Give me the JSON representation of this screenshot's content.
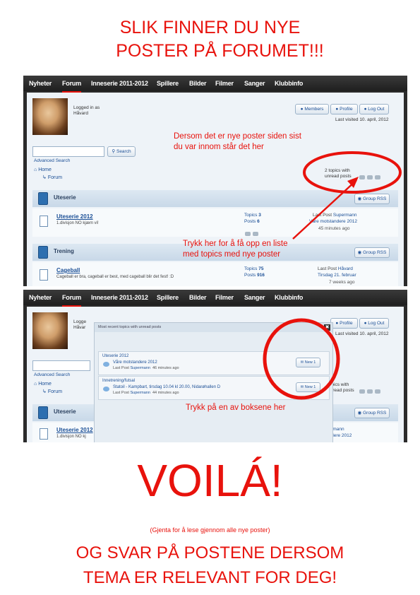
{
  "header": {
    "line1": "SLIK FINNER DU NYE",
    "line2": "POSTER PÅ FORUMET!!!"
  },
  "nav": {
    "items": [
      "Nyheter",
      "Forum",
      "Inneserie 2011-2012",
      "Spillere",
      "Bilder",
      "Filmer",
      "Sanger",
      "Klubbinfo"
    ],
    "active": "Forum"
  },
  "user": {
    "logged_in_as": "Logged in as",
    "name": "Håvard",
    "members": "Members",
    "profile": "Profile",
    "logout": "Log Out",
    "last_visited": "Last visited 10. april, 2012"
  },
  "search": {
    "button": "Search",
    "advanced": "Advanced Search"
  },
  "breadcrumb": {
    "home": "Home",
    "forum": "Forum"
  },
  "unread": {
    "line1": "2 topics with",
    "line2": "unread posts"
  },
  "categories": [
    {
      "name": "Uteserie",
      "rss": "Group RSS",
      "forum": {
        "title": "Uteserie 2012",
        "desc": "1.divisjon NO kjæm vi!",
        "topics_label": "Topics",
        "topics": "3",
        "posts_label": "Posts",
        "posts": "6",
        "last_post_label": "Last Post",
        "last_user": "Supermann",
        "last_topic": "Våre motstandere 2012",
        "last_time": "45 minutes ago"
      }
    },
    {
      "name": "Trening",
      "rss": "Group RSS",
      "forum": {
        "title": "Cageball",
        "desc": "Cageball er bra, cageball er best, med cageball blir det fest! :D",
        "topics_label": "Topics",
        "topics": "75",
        "posts_label": "Posts",
        "posts": "916",
        "last_post_label": "Last Post",
        "last_user": "Håvard",
        "last_topic": "Tirsdag 21. februar",
        "last_time": "7 weeks ago"
      }
    }
  ],
  "annotations": {
    "dersom1": "Dersom det er nye poster siden sist",
    "dersom2": "du var innom står det her",
    "trykk1": "Trykk her for å få opp en liste",
    "trykk2": "med topics med nye poster",
    "boksene": "Trykk på en av boksene her"
  },
  "shot2": {
    "logged_partial": "Logge",
    "name_partial": "Håvar",
    "forum_partial": "Uteserie 2012",
    "desc_partial": "1.divisjon NO kj",
    "topics_partial": "topics with",
    "unread_partial": "unread posts",
    "last_user_partial": "Supermann",
    "last_topic_partial": "motstandere 2012"
  },
  "popup": {
    "title": "Most recent topics with unread posts",
    "items": [
      {
        "category": "Uteserie 2012",
        "topic": "Våre motstandere 2012",
        "last": "Last Post",
        "user": "Supermann",
        "time": "46 minutes ago",
        "new": "New 1"
      },
      {
        "category": "Innetrening/futsal",
        "topic": "Statoil - Kampbart, tirsdag 10.04 kl 20.00, Nidarøhallen D",
        "last": "Last Post",
        "user": "Supermann",
        "time": "44 minutes ago",
        "new": "New 1"
      }
    ]
  },
  "footer": {
    "voila": "VOILÁ!",
    "gjenta": "(Gjenta for å lese gjennom alle nye poster)",
    "svar1": "OG SVAR PÅ POSTENE DERSOM",
    "svar2": "TEMA ER RELEVANT FOR DEG!"
  },
  "colors": {
    "annotation_red": "#e8120c",
    "link_blue": "#1b4f96",
    "nav_bg": "#2b2b2b",
    "content_bg": "#eef3f8"
  }
}
